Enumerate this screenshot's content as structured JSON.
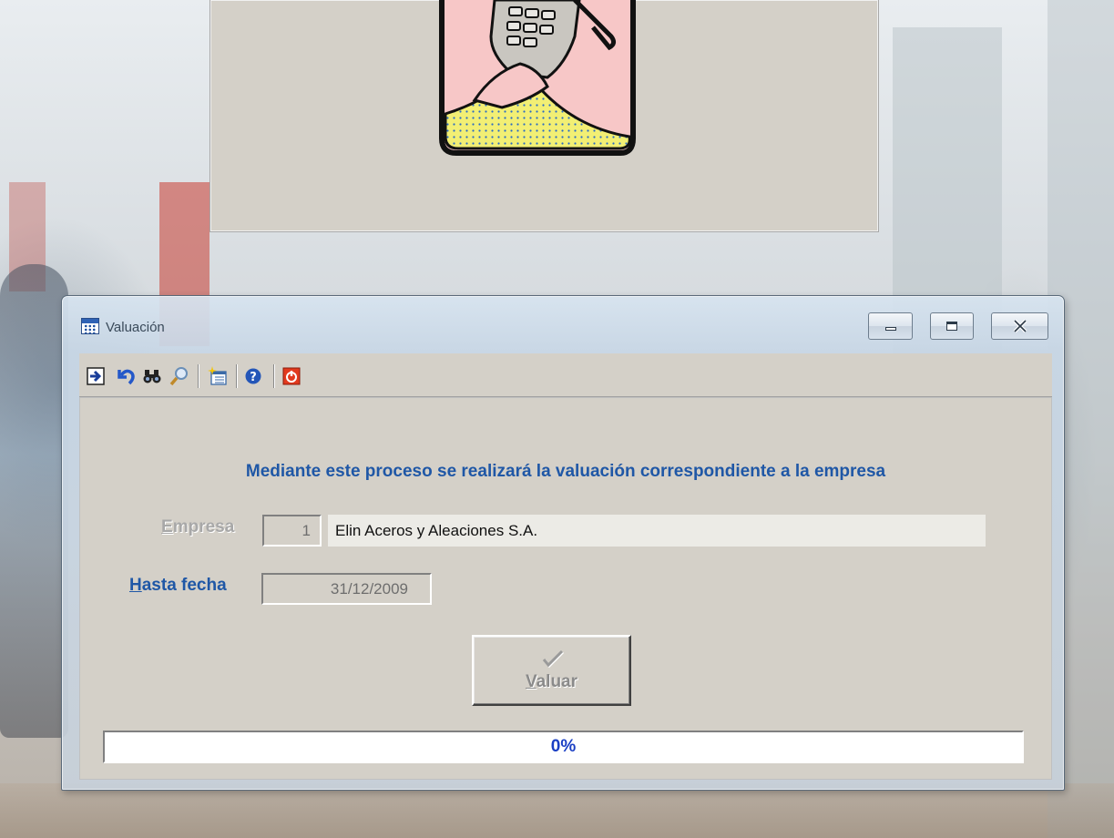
{
  "window": {
    "title": "Valuación"
  },
  "toolbar": {
    "items": [
      {
        "icon": "exit-arrow-icon"
      },
      {
        "icon": "undo-icon"
      },
      {
        "icon": "binoculars-icon"
      },
      {
        "icon": "magnifier-icon"
      },
      {
        "icon": "new-sheet-icon"
      },
      {
        "icon": "help-icon"
      },
      {
        "icon": "power-off-icon"
      }
    ]
  },
  "form": {
    "headline": "Mediante este proceso se realizará la valuación correspondiente a la empresa",
    "empresa_label_first": "E",
    "empresa_label_rest": "mpresa",
    "empresa_code": "1",
    "empresa_name": "Elin Aceros y Aleaciones S.A.",
    "hasta_label_first": "H",
    "hasta_label_rest": "asta fecha",
    "hasta_value": "31/12/2009",
    "valuar_first": "V",
    "valuar_rest": "aluar"
  },
  "progress": {
    "value": 0,
    "text": "0%"
  },
  "colors": {
    "accent": "#1f57a6",
    "disabled": "#a8a8a8",
    "panel": "#d4d0c8"
  }
}
